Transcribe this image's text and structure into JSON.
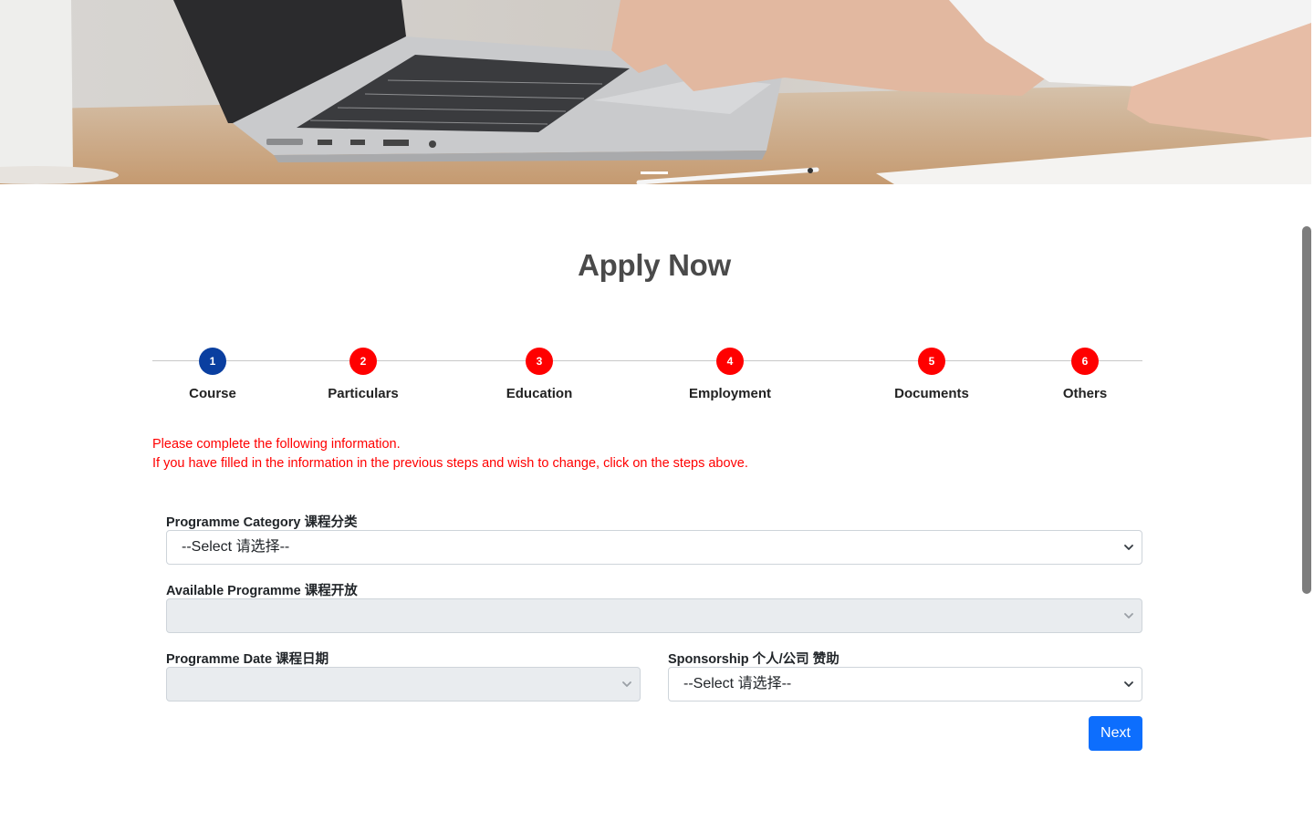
{
  "page": {
    "title": "Apply Now"
  },
  "stepper": {
    "steps": [
      {
        "number": "1",
        "label": "Course",
        "state": "active"
      },
      {
        "number": "2",
        "label": "Particulars",
        "state": "pending"
      },
      {
        "number": "3",
        "label": "Education",
        "state": "pending"
      },
      {
        "number": "4",
        "label": "Employment",
        "state": "pending"
      },
      {
        "number": "5",
        "label": "Documents",
        "state": "pending"
      },
      {
        "number": "6",
        "label": "Others",
        "state": "pending"
      }
    ],
    "active_color": "#0a3fa0",
    "pending_color": "#ff0000"
  },
  "notice": {
    "line1": "Please complete the following information.",
    "line2": "If you have filled in the information in the previous steps and wish to change, click on the steps above.",
    "color": "#ff0000"
  },
  "form": {
    "programme_category": {
      "label": "Programme Category 课程分类",
      "value": "--Select 请选择--"
    },
    "available_programme": {
      "label": "Available Programme 课程开放",
      "value": "",
      "disabled": true
    },
    "programme_date": {
      "label": "Programme Date 课程日期",
      "value": "",
      "disabled": true
    },
    "sponsorship": {
      "label": "Sponsorship 个人/公司 赞助",
      "value": "--Select 请选择--"
    },
    "next_label": "Next",
    "next_color": "#0d6efd"
  },
  "hero": {
    "carousel_active_index": 1
  }
}
